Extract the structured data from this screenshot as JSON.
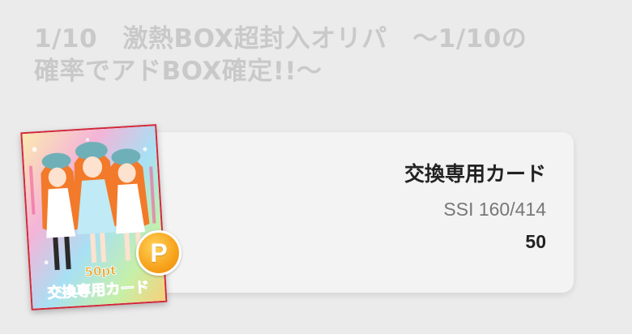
{
  "header": {
    "title_line1": "1/10　激熱BOX超封入オリパ　～1/10の",
    "title_line2": "確率でアドBOX確定!!～"
  },
  "card": {
    "name": "交換専用カード",
    "code": "SSI 160/414",
    "points": "50",
    "thumb_text_top": "50pt",
    "thumb_text_bottom": "交換専用カード"
  },
  "badge": {
    "label": "P",
    "color": "#f7a21b"
  },
  "colors": {
    "background": "#ebebeb",
    "panel": "#f3f3f3",
    "title": "#c9c9c9",
    "thumb_border": "#d0283a"
  }
}
